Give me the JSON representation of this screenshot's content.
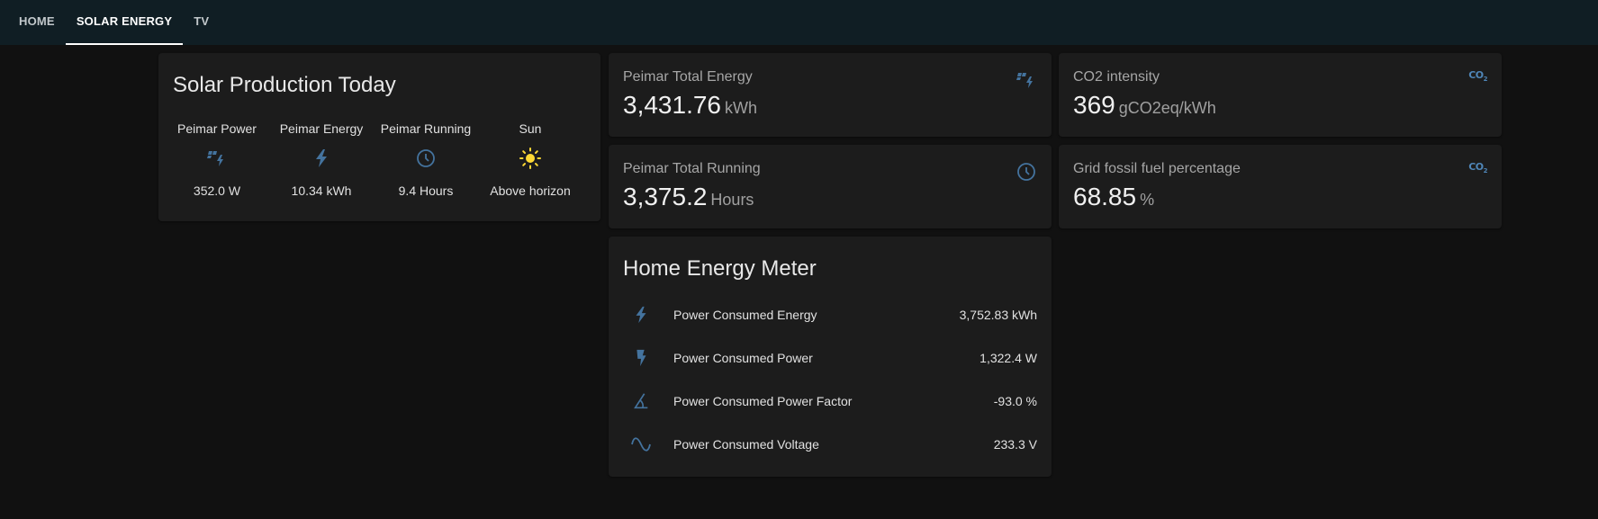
{
  "tabs": [
    {
      "label": "HOME",
      "active": false
    },
    {
      "label": "SOLAR ENERGY",
      "active": true
    },
    {
      "label": "TV",
      "active": false
    }
  ],
  "solar_card": {
    "title": "Solar Production Today",
    "items": [
      {
        "name": "Peimar Power",
        "icon": "solar-power-icon",
        "state": "352.0 W"
      },
      {
        "name": "Peimar Energy",
        "icon": "flash-icon",
        "state": "10.34 kWh"
      },
      {
        "name": "Peimar Running",
        "icon": "clock-icon",
        "state": "9.4 Hours"
      },
      {
        "name": "Sun",
        "icon": "sun-icon",
        "state": "Above horizon"
      }
    ]
  },
  "total_energy": {
    "name": "Peimar Total Energy",
    "value": "3,431.76",
    "unit": "kWh",
    "icon": "solar-power-icon"
  },
  "total_running": {
    "name": "Peimar Total Running",
    "value": "3,375.2",
    "unit": "Hours",
    "icon": "clock-icon"
  },
  "co2": {
    "name": "CO2 intensity",
    "value": "369",
    "unit": "gCO2eq/kWh",
    "icon": "molecule-co2-icon",
    "icon_text": "CO",
    "icon_sub": "2"
  },
  "fossil": {
    "name": "Grid fossil fuel percentage",
    "value": "68.85",
    "unit": "%",
    "icon": "molecule-co2-icon",
    "icon_text": "CO",
    "icon_sub": "2"
  },
  "meter_card": {
    "title": "Home Energy Meter",
    "rows": [
      {
        "name": "Power Consumed Energy",
        "value": "3,752.83 kWh",
        "icon": "flash-icon"
      },
      {
        "name": "Power Consumed Power",
        "value": "1,322.4 W",
        "icon": "flash-power-icon"
      },
      {
        "name": "Power Consumed Power Factor",
        "value": "-93.0 %",
        "icon": "angle-acute-icon"
      },
      {
        "name": "Power Consumed Voltage",
        "value": "233.3 V",
        "icon": "sine-wave-icon"
      }
    ]
  },
  "colors": {
    "background": "#111111",
    "topbar": "#101e24",
    "card": "#1c1c1c",
    "icon": "#44739e",
    "sun": "#fdd835"
  }
}
